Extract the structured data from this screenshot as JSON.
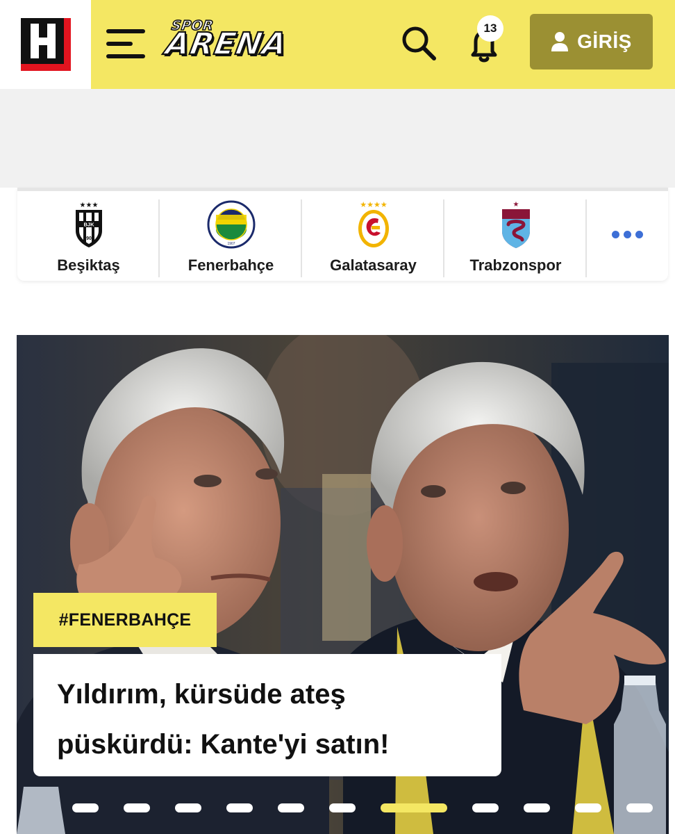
{
  "header": {
    "brand_icon": "hurriyet-h-logo",
    "menu_icon": "hamburger-menu-icon",
    "section_logo": {
      "top": "SPOR",
      "main": "ARENA"
    },
    "search_icon": "search-icon",
    "notifications": {
      "icon": "bell-icon",
      "count": "13"
    },
    "login": {
      "icon": "user-icon",
      "label": "GİRİŞ"
    }
  },
  "teams": [
    {
      "name": "Beşiktaş",
      "logo": "besiktas-crest"
    },
    {
      "name": "Fenerbahçe",
      "logo": "fenerbahce-crest"
    },
    {
      "name": "Galatasaray",
      "logo": "galatasaray-crest"
    },
    {
      "name": "Trabzonspor",
      "logo": "trabzonspor-crest"
    }
  ],
  "more_icon": "more-horizontal-icon",
  "hero": {
    "tag": "#FENERBAHÇE",
    "title_line1": "Yıldırım, kürsüde ateş",
    "title_line2": "püskürdü: Kante'yi satın!",
    "slide_count": 11,
    "active_slide": 7
  },
  "colors": {
    "brand_yellow": "#f4e763",
    "login_button": "#9b9033",
    "brand_red": "#e2141f",
    "dot_active": "#f4e763"
  }
}
